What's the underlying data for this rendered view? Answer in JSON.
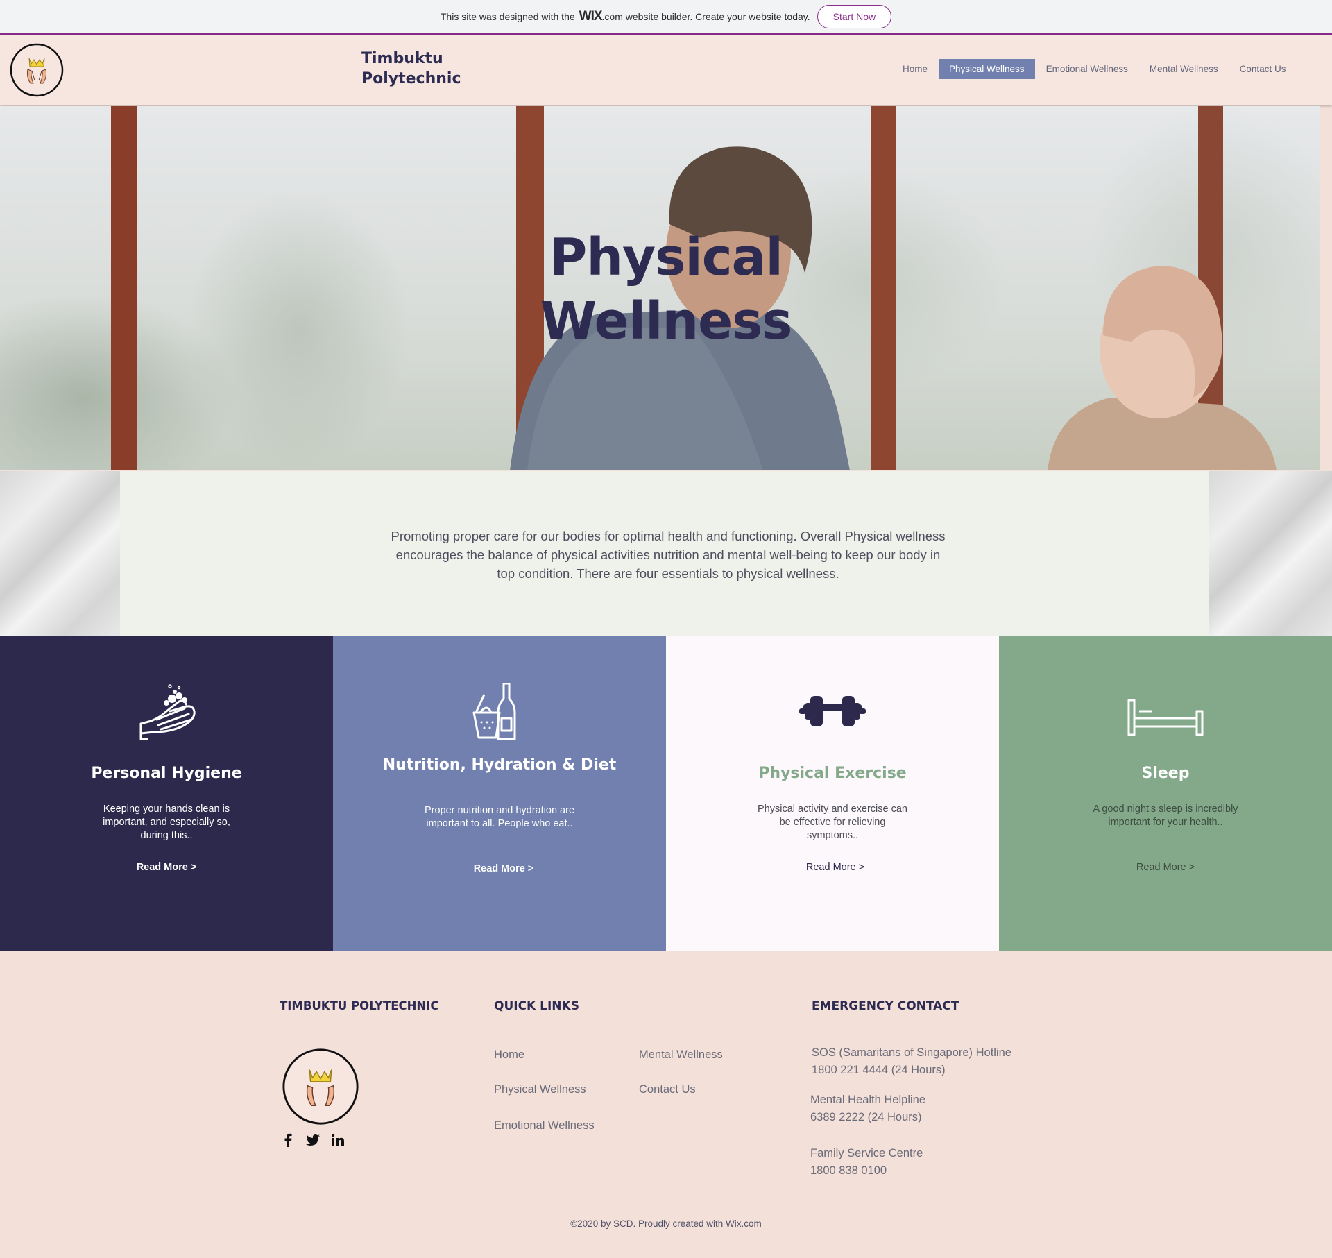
{
  "wix_banner": {
    "text_before": "This site was designed with the",
    "brand": "WIX",
    "text_after": ".com website builder. Create your website today.",
    "button": "Start Now"
  },
  "header": {
    "brand_line1": "Timbuktu",
    "brand_line2": "Polytechnic",
    "nav": [
      {
        "label": "Home",
        "active": false
      },
      {
        "label": "Physical Wellness",
        "active": true
      },
      {
        "label": "Emotional Wellness",
        "active": false
      },
      {
        "label": "Mental Wellness",
        "active": false
      },
      {
        "label": "Contact Us",
        "active": false
      }
    ]
  },
  "hero": {
    "title_line1": "Physical",
    "title_line2": "Wellness"
  },
  "intro": {
    "text": "Promoting proper care for our bodies for optimal health and functioning. Overall Physical wellness encourages the balance of physical activities nutrition and mental well-being to keep our body in top condition. There are four essentials to physical wellness."
  },
  "cards": [
    {
      "icon": "hand-washing-icon",
      "title": "Personal Hygiene",
      "text": "Keeping your hands clean is important, and especially so, during this..",
      "link": "Read More >",
      "bg": "#2d294d"
    },
    {
      "icon": "grocery-basket-bottle-icon",
      "title": "Nutrition, Hydration & Diet",
      "text": "Proper nutrition and hydration are important to all. People who eat..",
      "link": "Read More >",
      "bg": "#7180ae"
    },
    {
      "icon": "dumbbell-icon",
      "title": "Physical Exercise",
      "text": "Physical activity and exercise can be effective for relieving symptoms..",
      "link": "Read More >",
      "bg": "#fcf8fb"
    },
    {
      "icon": "bed-icon",
      "title": "Sleep",
      "text": "A good night's sleep is incredibly important for your health..",
      "link": "Read More >",
      "bg": "#84a98a"
    }
  ],
  "footer": {
    "brand_heading": "TIMBUKTU POLYTECHNIC",
    "quick_links_heading": "QUICK LINKS",
    "quick_links": [
      "Home",
      "Physical Wellness",
      "Emotional Wellness",
      "Mental Wellness",
      "Contact Us"
    ],
    "emergency_heading": "EMERGENCY CONTACT",
    "contacts": [
      {
        "name": "SOS (Samaritans of Singapore) Hotline",
        "number": "1800 221 4444 (24 Hours)"
      },
      {
        "name": "Mental Health Helpline",
        "number": "6389 2222 (24 Hours)"
      },
      {
        "name": "Family Service Centre",
        "number": "1800 838 0100"
      }
    ],
    "social": [
      "facebook-icon",
      "twitter-icon",
      "linkedin-icon"
    ],
    "copyright": "©2020 by SCD. Proudly created with Wix.com"
  },
  "colors": {
    "accent_purple": "#8a2c8c",
    "navy": "#2d294d",
    "periwinkle": "#7180ae",
    "sage": "#84a98a",
    "blush": "#f2e0d9"
  }
}
